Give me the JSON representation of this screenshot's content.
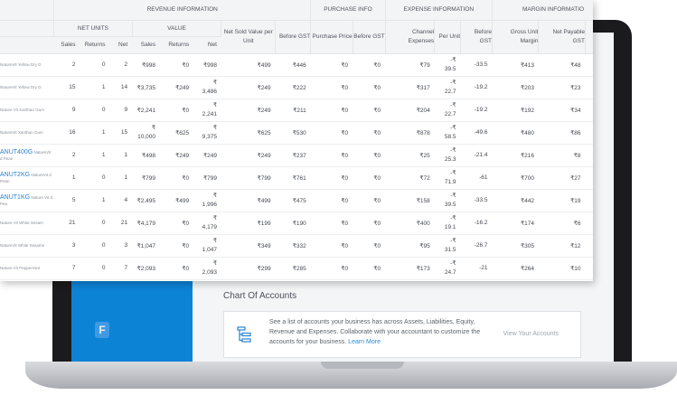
{
  "table": {
    "groups": [
      "REVENUE INFORMATION",
      "PURCHASE INFO",
      "EXPENSE INFORMATION",
      "MARGIN INFORMATIO"
    ],
    "subgroups": [
      "NET UNITS",
      "VALUE"
    ],
    "columns": [
      "Sales",
      "Returns",
      "Net",
      "Sales",
      "Returns",
      "Net",
      "Net Sold Value per Unit",
      "Before GST",
      "Purchase Price",
      "Before GST",
      "Channel Expenses",
      "Per Unit",
      "Before GST",
      "Gross Unit Margin",
      "Net Payable GST",
      "Ne M"
    ],
    "rows": [
      {
        "code": "",
        "name": "NatureVit Yellow Dry D",
        "cells": [
          "2",
          "0",
          "2",
          "₹998",
          "₹0",
          "₹998",
          "₹499",
          "₹446",
          "₹0",
          "₹0",
          "₹79",
          "-₹ 39.5",
          "-33.5",
          "₹413",
          "₹48"
        ]
      },
      {
        "code": "",
        "name": "NatureVit Yellow Dry D",
        "cells": [
          "15",
          "1",
          "14",
          "₹3,735",
          "₹249",
          "₹ 3,486",
          "₹249",
          "₹222",
          "₹0",
          "₹0",
          "₹317",
          "-₹ 22.7",
          "-19.2",
          "₹203",
          "₹23"
        ]
      },
      {
        "code": "",
        "name": "Nature Vit Xanthan Gum",
        "cells": [
          "9",
          "0",
          "9",
          "₹2,241",
          "₹0",
          "₹ 2,241",
          "₹249",
          "₹211",
          "₹0",
          "₹0",
          "₹204",
          "-₹ 22.7",
          "-19.2",
          "₹192",
          "₹34"
        ]
      },
      {
        "code": "",
        "name": "NatureVit Xanthan Gum",
        "cells": [
          "16",
          "1",
          "15",
          "₹ 10,000",
          "₹625",
          "₹ 9,375",
          "₹625",
          "₹530",
          "₹0",
          "₹0",
          "₹878",
          "-₹ 58.5",
          "-49.6",
          "₹480",
          "₹86"
        ]
      },
      {
        "code": "ANUT400G",
        "name": "NatureVit d Pean",
        "cells": [
          "2",
          "1",
          "1",
          "₹498",
          "₹249",
          "₹249",
          "₹249",
          "₹237",
          "₹0",
          "₹0",
          "₹25",
          "-₹ 25.3",
          "-21.4",
          "₹216",
          "₹8"
        ]
      },
      {
        "code": "ANUT2KG",
        "name": "NatureVit d Pean",
        "cells": [
          "1",
          "0",
          "1",
          "₹799",
          "₹0",
          "₹799",
          "₹799",
          "₹761",
          "₹0",
          "₹0",
          "₹72",
          "-₹ 71.9",
          "-61",
          "₹700",
          "₹27"
        ]
      },
      {
        "code": "ANUT1KG",
        "name": "Nature Vit d Pea",
        "cells": [
          "5",
          "1",
          "4",
          "₹2,495",
          "₹499",
          "₹ 1,996",
          "₹499",
          "₹475",
          "₹0",
          "₹0",
          "₹158",
          "-₹ 39.5",
          "-33.5",
          "₹442",
          "₹19"
        ]
      },
      {
        "code": "",
        "name": "Nature Vit White Sesam",
        "cells": [
          "21",
          "0",
          "21",
          "₹4,179",
          "₹0",
          "₹ 4,179",
          "₹199",
          "₹190",
          "₹0",
          "₹0",
          "₹400",
          "-₹ 19.1",
          "-16.2",
          "₹174",
          "₹6"
        ]
      },
      {
        "code": "",
        "name": "NatureVit White Sesame",
        "cells": [
          "3",
          "0",
          "3",
          "₹1,047",
          "₹0",
          "₹ 1,047",
          "₹349",
          "₹332",
          "₹0",
          "₹0",
          "₹95",
          "-₹ 31.5",
          "-26.7",
          "₹305",
          "₹12"
        ]
      },
      {
        "code": "",
        "name": "Nature Vit Peppermint",
        "cells": [
          "7",
          "0",
          "7",
          "₹2,093",
          "₹0",
          "₹ 2,093",
          "₹299",
          "₹285",
          "₹0",
          "₹0",
          "₹173",
          "-₹ 24.7",
          "-21",
          "₹264",
          "₹10"
        ]
      }
    ]
  },
  "chart_of_accounts": {
    "title": "Chart Of Accounts",
    "description": "See a list of accounts your business has across Assets, Liabilities, Equity, Revenue and Expenses. Collaborate with your accountant to customize the accounts for your business.",
    "learn_more": "Learn More",
    "view_link": "View Your Accounts"
  },
  "sidebar": {
    "logo_letter": "F"
  },
  "colors": {
    "sidebar": "#0d83d6",
    "link": "#2a83cf",
    "laptop": "#1b1b1d"
  }
}
